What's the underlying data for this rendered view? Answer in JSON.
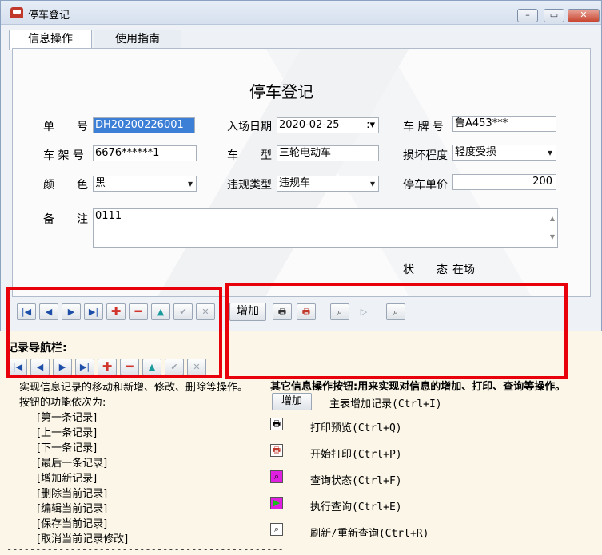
{
  "window": {
    "title": "停车登记"
  },
  "tabs": [
    {
      "label": "信息操作"
    },
    {
      "label": "使用指南"
    }
  ],
  "form": {
    "heading": "停车登记",
    "order_no": {
      "label": "单　　号",
      "value": "DH20200226001"
    },
    "entry_date": {
      "label": "入场日期",
      "value": "2020-02-25"
    },
    "plate": {
      "label": "车 牌 号",
      "value": "鲁A453***"
    },
    "frame_no": {
      "label": "车 架 号",
      "value": "6676******1"
    },
    "vehicle_type": {
      "label": "车　　型",
      "value": "三轮电动车"
    },
    "damage": {
      "label": "损坏程度",
      "value": "轻度受损"
    },
    "color": {
      "label": "颜　　色",
      "value": "黑"
    },
    "violation": {
      "label": "违规类型",
      "value": "违规车"
    },
    "unit_price": {
      "label": "停车单价",
      "value": "200"
    },
    "remark": {
      "label": "备　　注",
      "value": "0111"
    },
    "status": {
      "label": "状　　态",
      "value": "在场"
    }
  },
  "toolbar": {
    "add_label": "增加"
  },
  "help": {
    "nav_title": "记录导航栏:",
    "nav_desc": "实现信息记录的移动和新增、修改、删除等操作。",
    "nav_order": "按钮的功能依次为:",
    "nav_items": [
      "[第一条记录]",
      "[上一条记录]",
      "[下一条记录]",
      "[最后一条记录]",
      "[增加新记录]",
      "[删除当前记录]",
      "[编辑当前记录]",
      "[保存当前记录]",
      "[取消当前记录修改]"
    ],
    "other_title": "其它信息操作按钮:用来实现对信息的增加、打印、查询等操作。",
    "add_btn": "增加",
    "other_items": [
      "主表增加记录(Ctrl+I)",
      "打印预览(Ctrl+Q)",
      "开始打印(Ctrl+P)",
      "查询状态(Ctrl+F)",
      "执行查询(Ctrl+E)",
      "刷新/重新查询(Ctrl+R)"
    ],
    "divider": "------------------------------------------------"
  }
}
